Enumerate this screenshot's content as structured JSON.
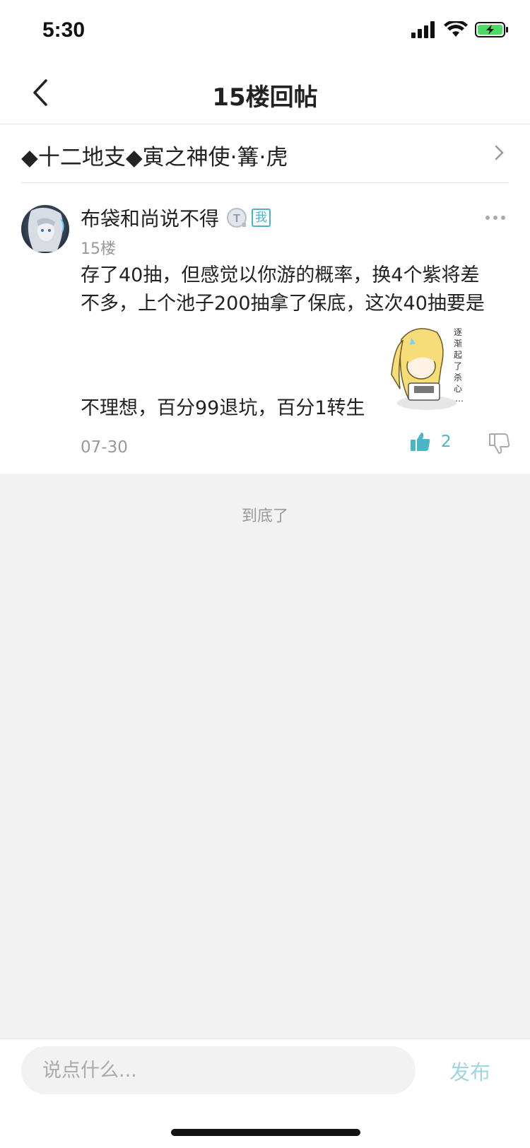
{
  "status_bar": {
    "time": "5:30"
  },
  "nav": {
    "title": "15楼回帖"
  },
  "thread": {
    "title": "◆十二地支◆寅之神使·篝·虎"
  },
  "post": {
    "author": "布袋和尚说不得",
    "level_badge_letter": "T",
    "me_badge": "我",
    "floor": "15楼",
    "lines": [
      "存了40抽，但感觉以你游的概率，换4个紫将差",
      "不多，上个池子200抽拿了保底，这次40抽要是"
    ],
    "line_after_sticker": "不理想，百分99退坑，百分1转生",
    "sticker_text": "逐渐起了杀心…",
    "date": "07-30",
    "likes": "2"
  },
  "end_text": "到底了",
  "comment": {
    "placeholder": "说点什么...",
    "publish_label": "发布"
  },
  "colors": {
    "accent": "#4ab5c6",
    "publish_disabled": "#9fd6df",
    "background": "#f2f2f2"
  }
}
